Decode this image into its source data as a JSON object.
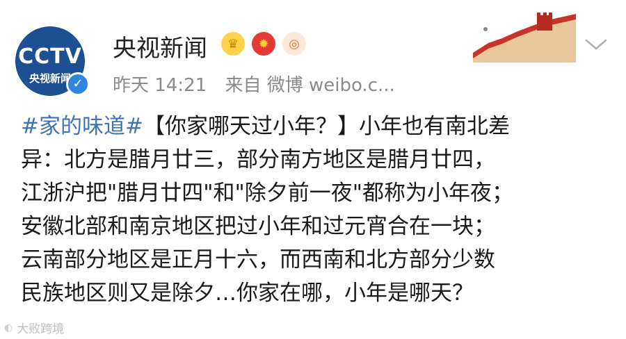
{
  "author": {
    "name": "央视新闻",
    "avatar_logo": "CCTV",
    "avatar_sub": "央视新闻",
    "verified_icon": "verified-checkmark-icon"
  },
  "meta": {
    "time": "昨天 14:21",
    "source": "来自 微博 weibo.c..."
  },
  "post": {
    "topic": "#家的味道#",
    "line1_rest": "【你家哪天过小年？】小年也有南北差",
    "line2": "异：北方是腊月廿三，部分南方地区是腊月廿四，",
    "line3": "江浙沪把\"腊月廿四\"和\"除夕前一夜\"都称为小年夜；",
    "line4": "安徽北部和南京地区把过小年和过元宵合在一块；",
    "line5": "云南部分地区是正月十六，而西南和北方部分少数",
    "line6": "民族地区则又是除夕…你家在哪，小年是哪天？"
  },
  "watermark": {
    "text": "大败跨境"
  },
  "colors": {
    "topic": "#3f73b3",
    "meta_gray": "#8a8a8a",
    "brand_blue": "#1d4f93"
  }
}
